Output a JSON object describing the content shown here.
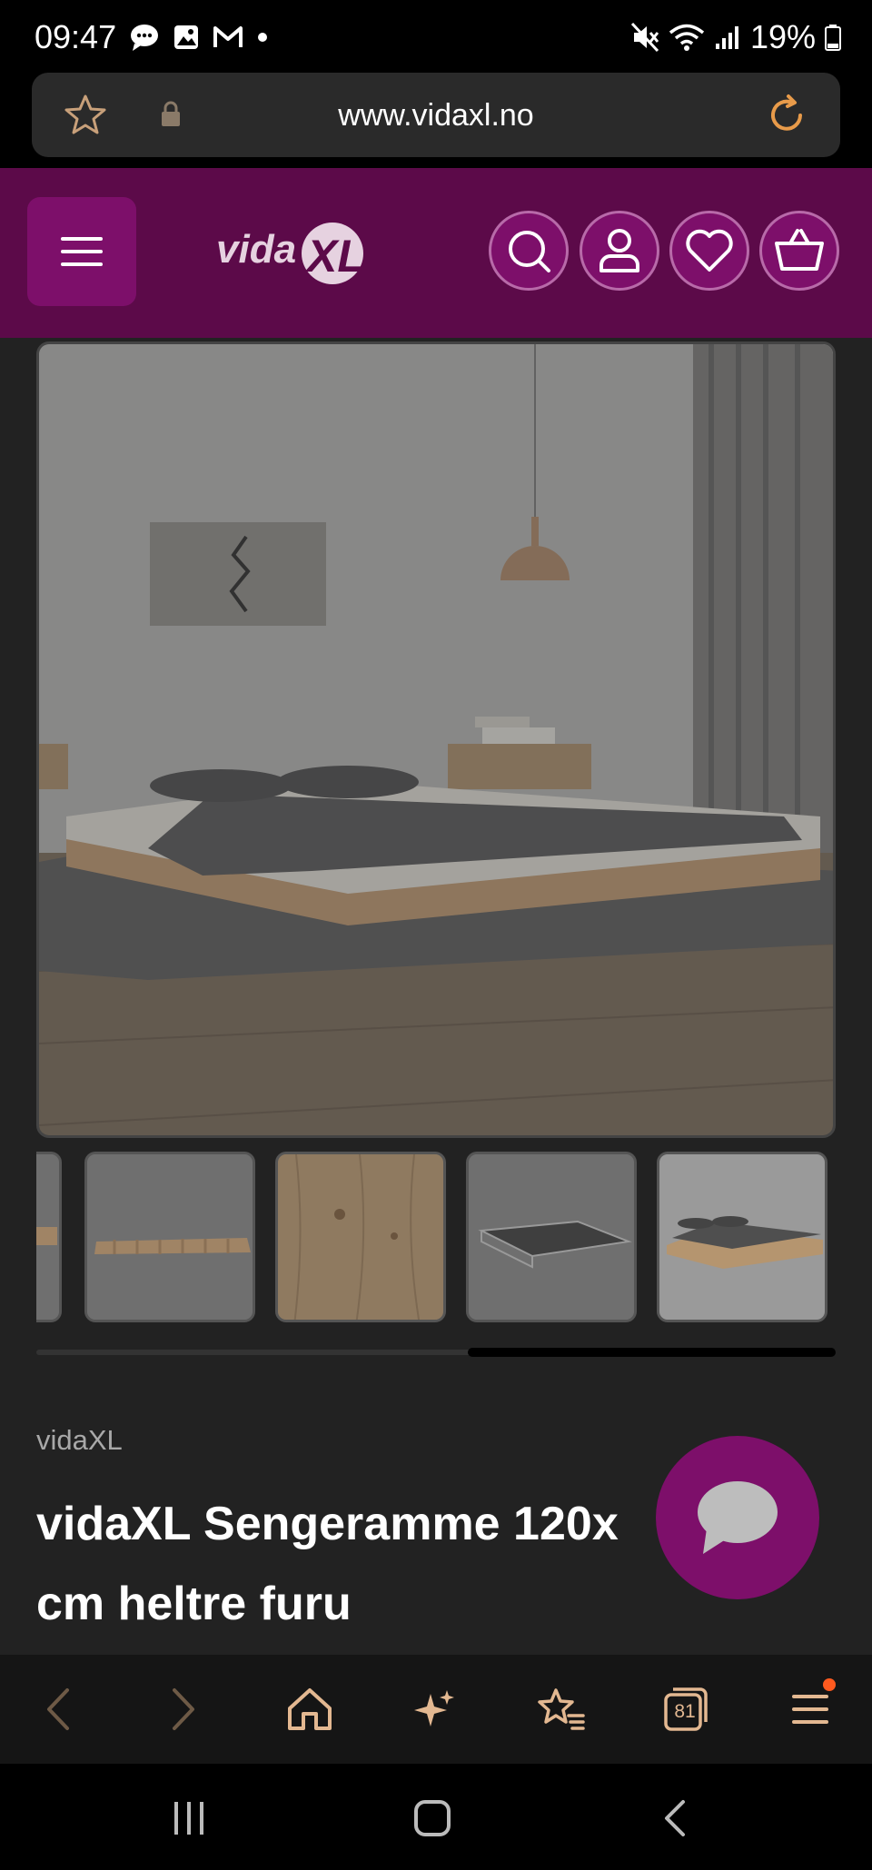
{
  "status_bar": {
    "time": "09:47",
    "battery": "19%",
    "left_icons": [
      "chat-bubble-icon",
      "gallery-icon",
      "gmail-icon",
      "dot-icon"
    ],
    "right_icons": [
      "mute-icon",
      "wifi-icon",
      "signal-icon",
      "battery-icon"
    ]
  },
  "url_bar": {
    "url": "www.vidaxl.no"
  },
  "site_header": {
    "logo_text": "vidaXL",
    "accent_color": "#5c0a49",
    "button_color": "#7d0f6a",
    "icons": [
      "menu-icon",
      "search-icon",
      "account-icon",
      "wishlist-heart-icon",
      "cart-basket-icon"
    ]
  },
  "product": {
    "brand": "vidaXL",
    "title": "vidaXL Sengeramme 120x cm heltre furu",
    "thumbnails": [
      "thumb-partial",
      "thumb-slatted-frame",
      "thumb-wood-grain",
      "thumb-dimensions-drawing",
      "thumb-bed-with-pillows"
    ]
  },
  "bottom_toolbar": {
    "tabs_count": "81",
    "items": [
      "back-icon",
      "forward-icon",
      "home-icon",
      "sparkle-icon",
      "bookmarks-icon",
      "tabs-icon",
      "menu-icon"
    ]
  },
  "system_nav": {
    "items": [
      "recents-icon",
      "home-icon",
      "back-icon"
    ]
  }
}
